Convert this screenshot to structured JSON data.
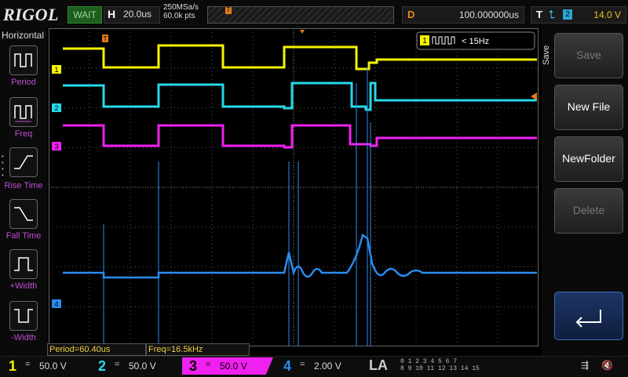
{
  "header": {
    "brand": "RIGOL",
    "run_state": "WAIT",
    "horizontal_label": "H",
    "timebase": "20.0us",
    "sample_rate": "250MSa/s",
    "memory_depth": "60.0k pts",
    "delay_label": "D",
    "delay_value": "100.000000us",
    "trigger_label": "T",
    "trigger_channel": "2",
    "trigger_level": "14.0 V"
  },
  "left_panel": {
    "title": "Horizontal",
    "items": [
      {
        "label": "Period"
      },
      {
        "label": "Freq"
      },
      {
        "label": "Rise Time"
      },
      {
        "label": "Fall Time"
      },
      {
        "label": "+Width"
      },
      {
        "label": "-Width"
      }
    ]
  },
  "right_menu": {
    "tab": "Save",
    "buttons": [
      {
        "label": "Save",
        "enabled": false
      },
      {
        "label": "New File",
        "enabled": true
      },
      {
        "label": "NewFolder",
        "enabled": true
      },
      {
        "label": "Delete",
        "enabled": false
      }
    ],
    "enter_icon": "enter-arrow-icon"
  },
  "counter": {
    "channel": "1",
    "text": "< 15Hz"
  },
  "measurements": {
    "period": "Period=60.40us",
    "freq": "Freq=16.5kHz"
  },
  "channels": [
    {
      "id": "1",
      "coupling": "=",
      "scale": "50.0 V",
      "color": "#f5f500"
    },
    {
      "id": "2",
      "coupling": "=",
      "scale": "50.0 V",
      "color": "#26d9e8"
    },
    {
      "id": "3",
      "coupling": "=",
      "scale": "50.0 V",
      "color": "#f020f0"
    },
    {
      "id": "4",
      "coupling": "=",
      "scale": "2.00 V",
      "color": "#2a8cf0"
    }
  ],
  "la": {
    "label": "LA",
    "digits_row1": "0 1 2 3 4 5 6 7",
    "digits_row2": "8 9 10 11 12 13 14 15"
  },
  "status_icons": [
    "usb-icon",
    "speaker-muted-icon"
  ]
}
